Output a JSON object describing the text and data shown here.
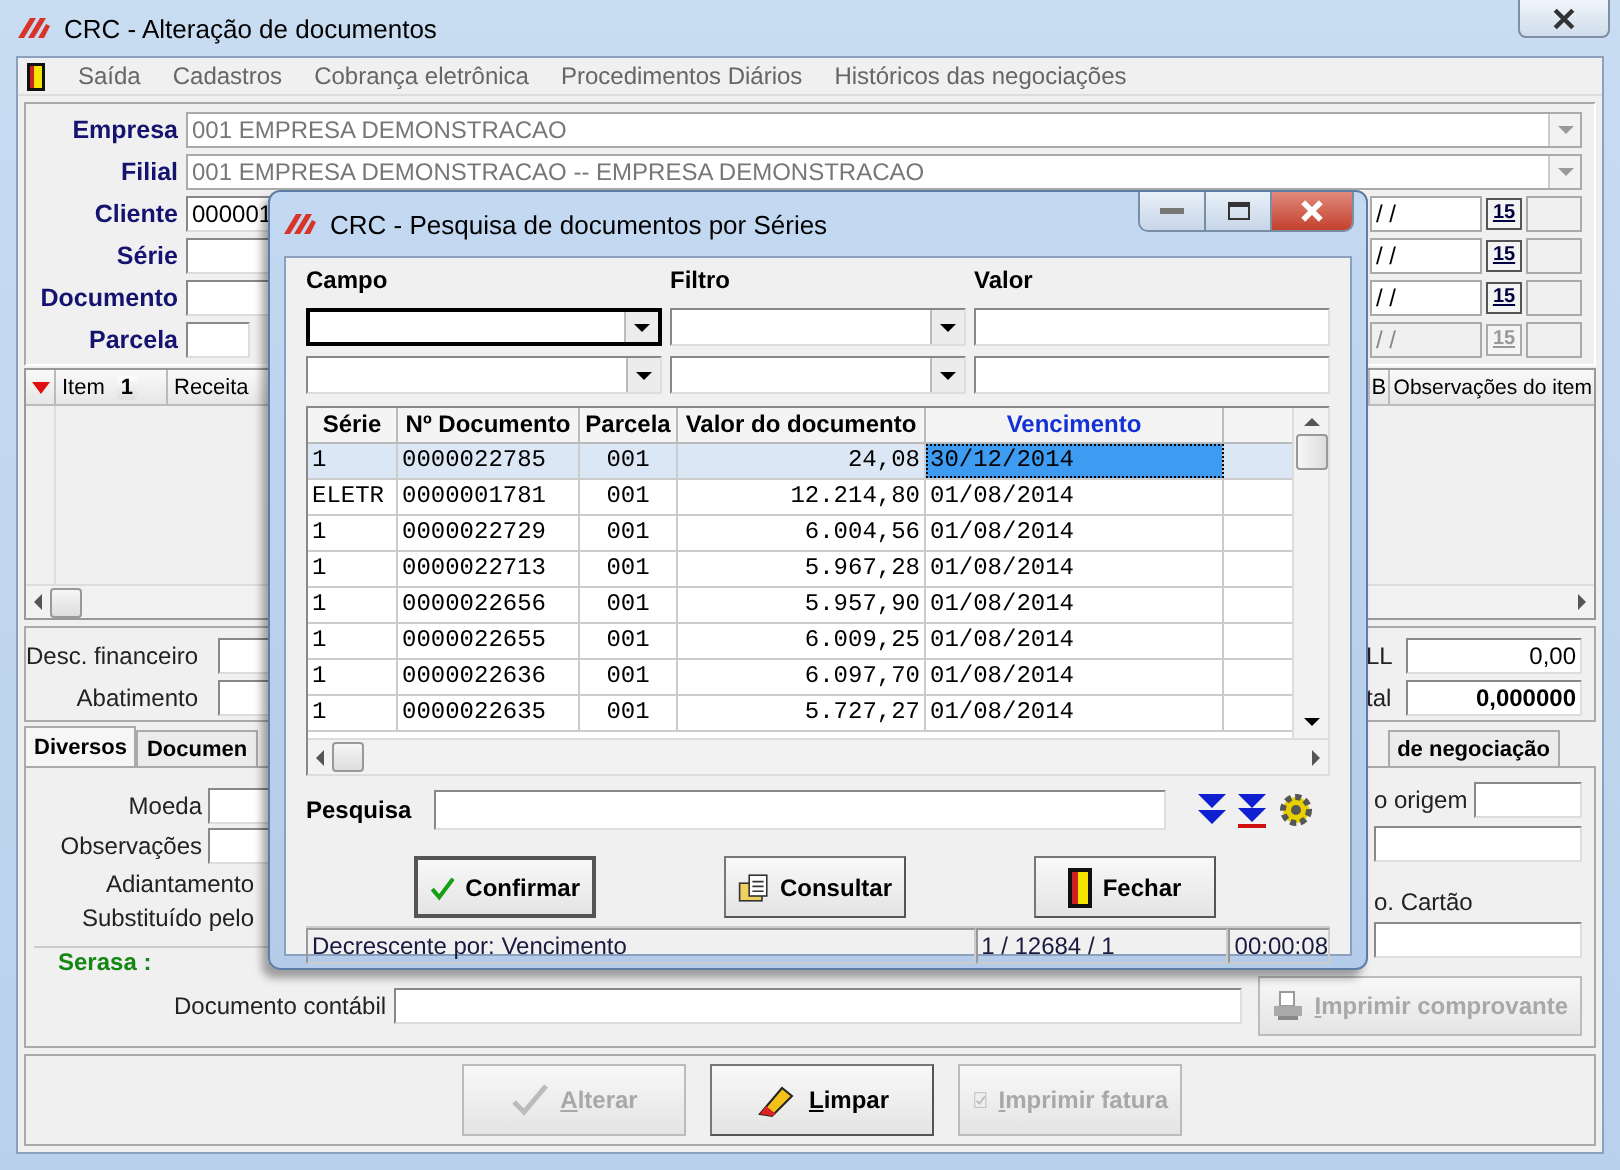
{
  "window": {
    "title": "CRC - Alteração de documentos"
  },
  "menu": [
    "Saída",
    "Cadastros",
    "Cobrança eletrônica",
    "Procedimentos Diários",
    "Históricos das negociações"
  ],
  "header_rows": [
    {
      "label": "Empresa",
      "value": "001 EMPRESA DEMONSTRACAO",
      "kind": "combo"
    },
    {
      "label": "Filial",
      "value": "001 EMPRESA DEMONSTRACAO -- EMPRESA DEMONSTRACAO",
      "kind": "combo"
    },
    {
      "label": "Cliente",
      "value": "000001",
      "kind": "text",
      "date": {
        "value": "/ /",
        "button": "15",
        "disabled": false
      }
    },
    {
      "label": "Série",
      "kind": "text",
      "date": {
        "value": "/ /",
        "button": "15",
        "disabled": false
      }
    },
    {
      "label": "Documento",
      "kind": "text",
      "date": {
        "value": "/ /",
        "button": "15",
        "disabled": false
      }
    },
    {
      "label": "Parcela",
      "kind": "short",
      "date": {
        "value": "/ /",
        "button": "15",
        "disabled": true
      }
    }
  ],
  "items_grid": {
    "columns_left": [
      {
        "label": "Item",
        "sort_badge": "1"
      },
      {
        "label": "Receita"
      }
    ],
    "columns_right": [
      "B",
      "Observações do item"
    ]
  },
  "totals": [
    {
      "label": "Desc. financeiro",
      "right_label": "LL",
      "right_value": "0,00",
      "bold": false
    },
    {
      "label": "Abatimento",
      "right_label": "tal",
      "right_value": "0,000000",
      "bold": true
    }
  ],
  "tabs": [
    {
      "label": "Diversos",
      "selected": true
    },
    {
      "label": "Documen",
      "selected": false
    },
    {
      "label": "de negociação",
      "selected": false
    }
  ],
  "tab_panel": {
    "left_fields": [
      {
        "label": "Moeda",
        "kind": "field"
      },
      {
        "label": "Observações",
        "kind": "field"
      },
      {
        "label": "Adiantamento",
        "kind": "label"
      },
      {
        "label": "Substituído pelo",
        "kind": "label"
      },
      {
        "label": "Serasa :",
        "kind": "status"
      }
    ],
    "origin_label": "o origem",
    "card_label": "o. Cartão",
    "accounting_label": "Documento contábil",
    "print_button": {
      "label": "Imprimir comprovante",
      "disabled": true
    }
  },
  "buttons": [
    {
      "label": "Alterar",
      "disabled": true
    },
    {
      "label": "Limpar",
      "disabled": false
    },
    {
      "label": "Imprimir fatura",
      "disabled": true
    }
  ],
  "dialog": {
    "title": "CRC - Pesquisa de documentos por Séries",
    "filter_headers": [
      "Campo",
      "Filtro",
      "Valor"
    ],
    "filter_rows": [
      {
        "focused": true
      },
      {
        "focused": false
      }
    ],
    "columns": [
      {
        "label": "Série",
        "sorted": false
      },
      {
        "label": "Nº Documento",
        "sorted": false
      },
      {
        "label": "Parcela",
        "sorted": false
      },
      {
        "label": "Valor do documento",
        "sorted": false
      },
      {
        "label": "Vencimento",
        "sorted": true
      }
    ],
    "rows": [
      {
        "cells": [
          "1",
          "0000022785",
          "001",
          "24,08",
          "30/12/2014"
        ],
        "selected": true
      },
      {
        "cells": [
          "ELETR",
          "0000001781",
          "001",
          "12.214,80",
          "01/08/2014"
        ],
        "selected": false
      },
      {
        "cells": [
          "1",
          "0000022729",
          "001",
          "6.004,56",
          "01/08/2014"
        ],
        "selected": false
      },
      {
        "cells": [
          "1",
          "0000022713",
          "001",
          "5.967,28",
          "01/08/2014"
        ],
        "selected": false
      },
      {
        "cells": [
          "1",
          "0000022656",
          "001",
          "5.957,90",
          "01/08/2014"
        ],
        "selected": false
      },
      {
        "cells": [
          "1",
          "0000022655",
          "001",
          "6.009,25",
          "01/08/2014"
        ],
        "selected": false
      },
      {
        "cells": [
          "1",
          "0000022636",
          "001",
          "6.097,70",
          "01/08/2014"
        ],
        "selected": false
      },
      {
        "cells": [
          "1",
          "0000022635",
          "001",
          "5.727,27",
          "01/08/2014"
        ],
        "selected": false
      }
    ],
    "search_label": "Pesquisa",
    "buttons": [
      {
        "label": "Confirmar"
      },
      {
        "label": "Consultar"
      },
      {
        "label": "Fechar"
      }
    ],
    "status": [
      "Decrescente por: Vencimento",
      "1 / 12684 / 1",
      "00:00:08"
    ]
  }
}
